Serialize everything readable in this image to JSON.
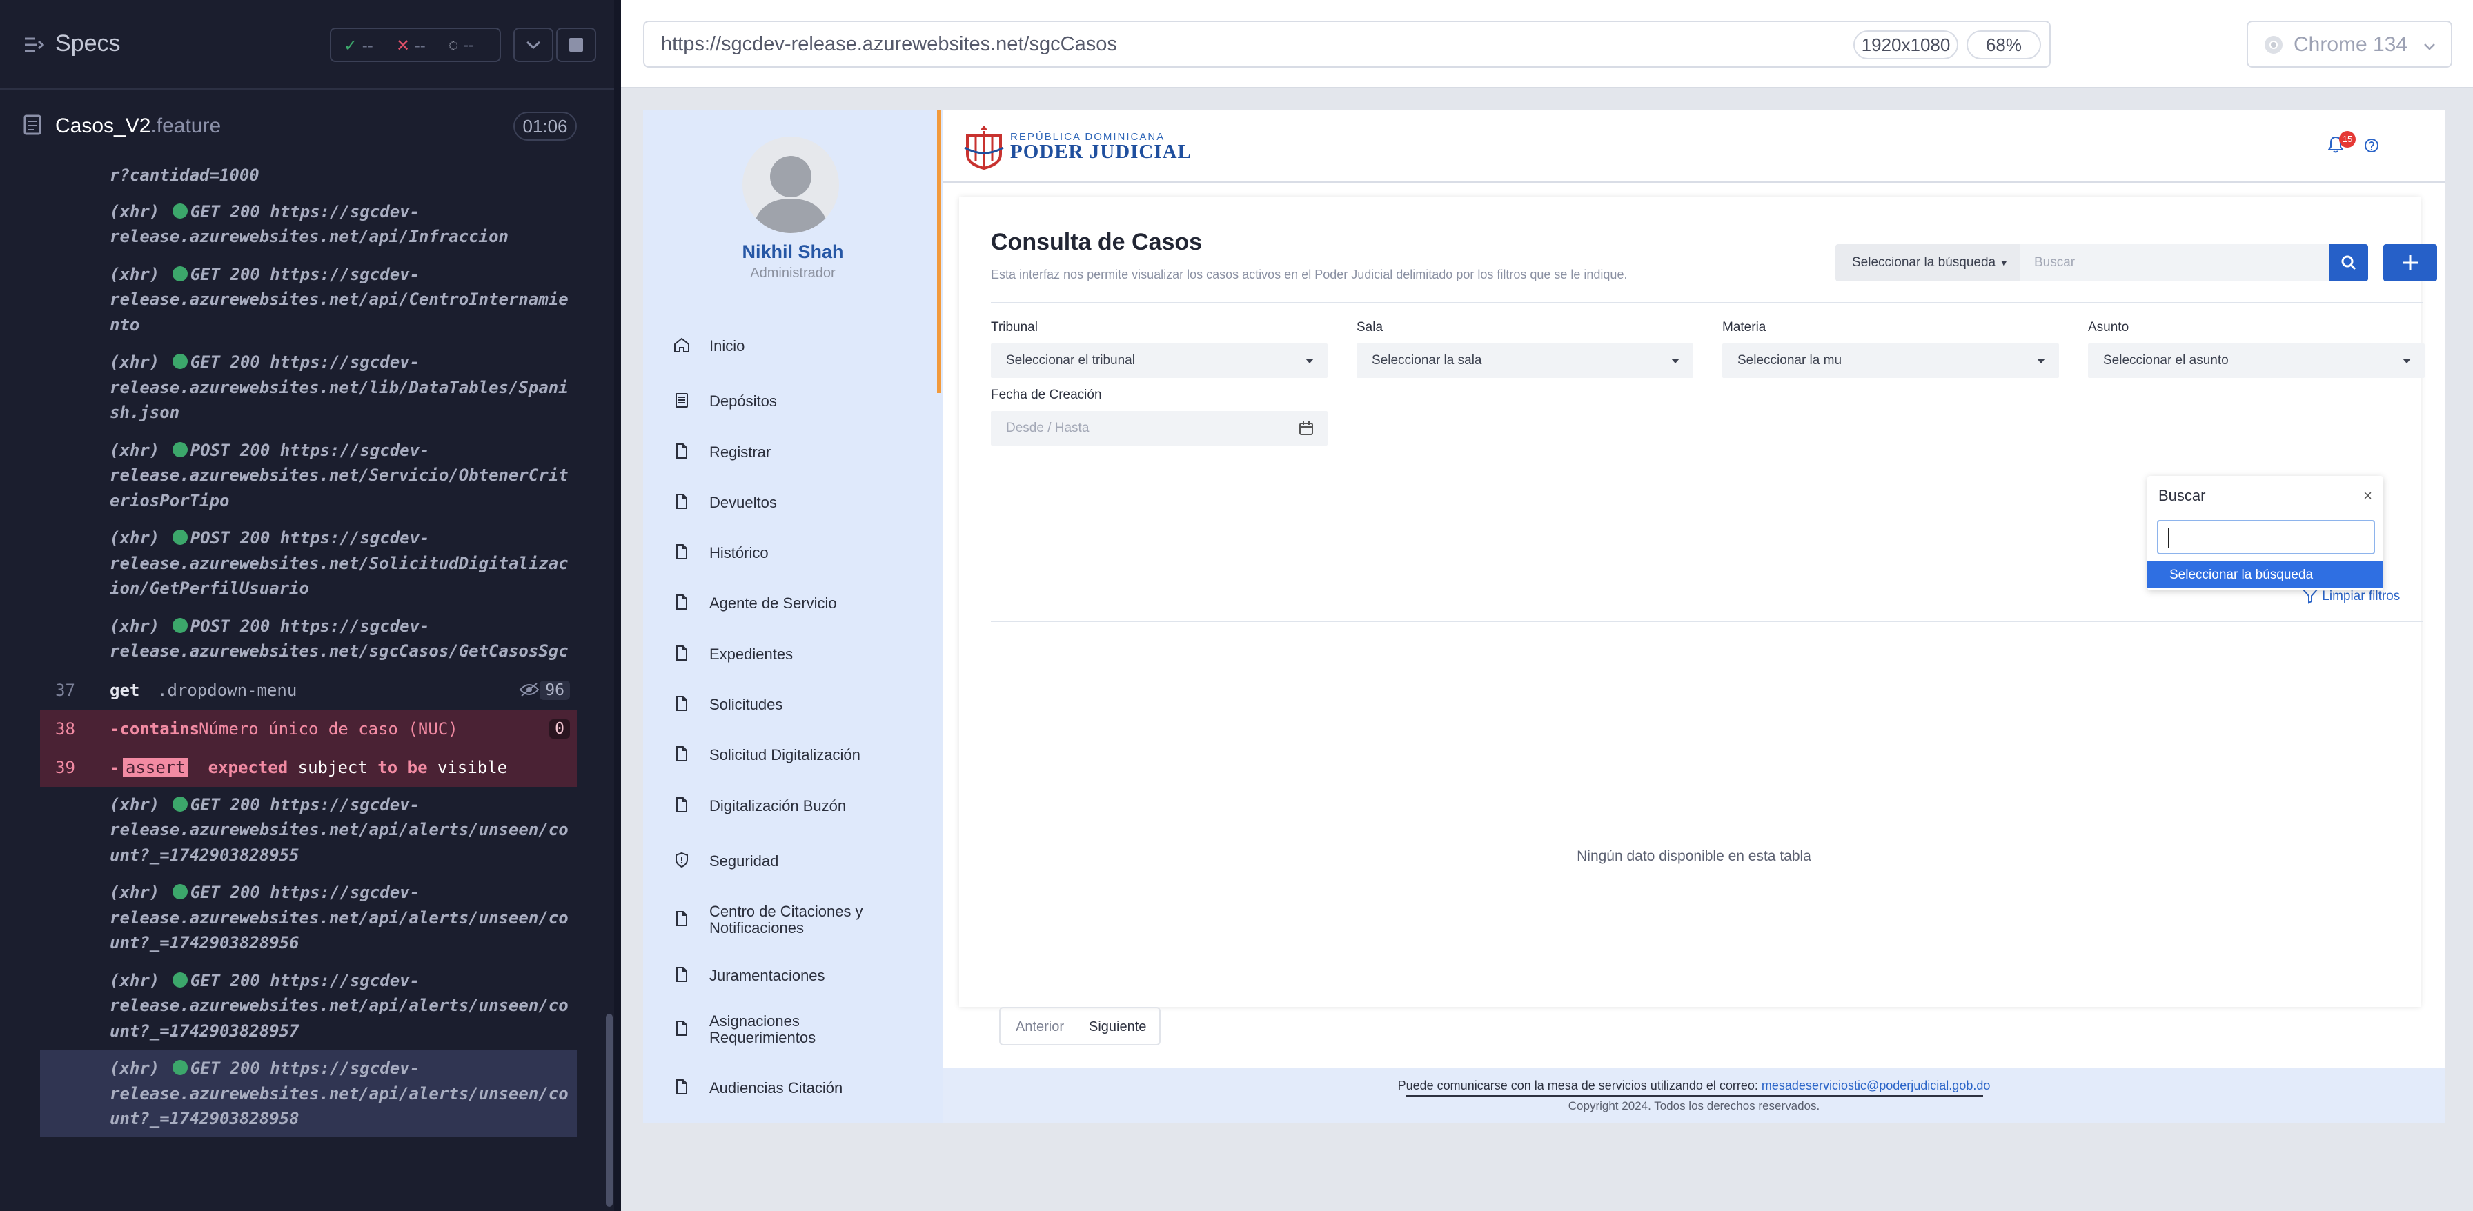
{
  "runner": {
    "title": "Specs",
    "stats": {
      "passed": "--",
      "failed": "--",
      "pending": "--"
    },
    "file": {
      "name": "Casos_V2",
      "ext": ".feature",
      "time": "01:06"
    },
    "log_top": [
      {
        "kind": "frag",
        "text": "r?cantidad=1000"
      },
      {
        "kind": "xhr",
        "lines": [
          "GET 200 https://sgcdev-",
          "release.azurewebsites.net/api/Infraccion"
        ]
      },
      {
        "kind": "xhr",
        "lines": [
          "GET 200 https://sgcdev-",
          "release.azurewebsites.net/api/CentroInternamie",
          "nto"
        ]
      },
      {
        "kind": "xhr",
        "lines": [
          "GET 200 https://sgcdev-",
          "release.azurewebsites.net/lib/DataTables/Spani",
          "sh.json"
        ]
      },
      {
        "kind": "xhr",
        "lines": [
          "POST 200 https://sgcdev-",
          "release.azurewebsites.net/Servicio/ObtenerCrit",
          "eriosPorTipo"
        ]
      },
      {
        "kind": "xhr",
        "lines": [
          "POST 200 https://sgcdev-",
          "release.azurewebsites.net/SolicitudDigitalizac",
          "ion/GetPerfilUsuario"
        ]
      },
      {
        "kind": "xhr",
        "lines": [
          "POST 200 https://sgcdev-",
          "release.azurewebsites.net/sgcCasos/GetCasosSgc"
        ]
      }
    ],
    "cmd37": {
      "num": "37",
      "name": "get",
      "msg": ".dropdown-menu",
      "count": "96"
    },
    "cmd38": {
      "num": "38",
      "name": "-contains",
      "msg": "Número único de caso (NUC)",
      "count": "0"
    },
    "cmd39": {
      "num": "39",
      "name": "-",
      "tag": "assert",
      "w1": "expected",
      "w2": "subject",
      "w3": "to be",
      "w4": "visible"
    },
    "log_bottom": [
      {
        "kind": "xhr",
        "lines": [
          "GET 200 https://sgcdev-",
          "release.azurewebsites.net/api/alerts/unseen/co",
          "unt?_=1742903828955"
        ]
      },
      {
        "kind": "xhr",
        "lines": [
          "GET 200 https://sgcdev-",
          "release.azurewebsites.net/api/alerts/unseen/co",
          "unt?_=1742903828956"
        ]
      },
      {
        "kind": "xhr",
        "lines": [
          "GET 200 https://sgcdev-",
          "release.azurewebsites.net/api/alerts/unseen/co",
          "unt?_=1742903828957"
        ]
      },
      {
        "kind": "xhr",
        "sel": true,
        "lines": [
          "GET 200 https://sgcdev-",
          "release.azurewebsites.net/api/alerts/unseen/co",
          "unt?_=1742903828958"
        ]
      }
    ]
  },
  "browser": {
    "url": "https://sgcdev-release.azurewebsites.net/sgcCasos",
    "viewport": "1920x1080",
    "zoom": "68%",
    "name": "Chrome 134"
  },
  "app": {
    "user": {
      "name": "Nikhil Shah",
      "role": "Administrador"
    },
    "logo": {
      "line1": "REPÚBLICA DOMINICANA",
      "line2": "PODER JUDICIAL"
    },
    "notifications": "15",
    "nav": [
      {
        "label": "Inicio",
        "icon": "home-icon"
      },
      {
        "label": "Depósitos",
        "icon": "archive-icon"
      },
      {
        "label": "Registrar",
        "icon": "file-icon"
      },
      {
        "label": "Devueltos",
        "icon": "file-icon"
      },
      {
        "label": "Histórico",
        "icon": "file-icon"
      },
      {
        "label": "Agente de Servicio",
        "icon": "file-icon"
      },
      {
        "label": "Expedientes",
        "icon": "file-icon"
      },
      {
        "label": "Solicitudes",
        "icon": "file-icon"
      },
      {
        "label": "Solicitud Digitalización",
        "icon": "file-icon"
      },
      {
        "label": "Digitalización Buzón",
        "icon": "file-icon"
      },
      {
        "label": "Seguridad",
        "icon": "shield-icon"
      },
      {
        "label": "Centro de Citaciones y Notificaciones",
        "icon": "file-icon"
      },
      {
        "label": "Juramentaciones",
        "icon": "file-icon"
      },
      {
        "label": "Asignaciones Requerimientos",
        "icon": "file-icon"
      },
      {
        "label": "Audiencias Citación",
        "icon": "file-icon"
      }
    ],
    "page": {
      "title": "Consulta de Casos",
      "desc": "Esta interfaz nos permite visualizar los casos activos en el Poder Judicial delimitado por los filtros que se le indique.",
      "search_select": "Seleccionar la búsqueda",
      "search_placeholder": "Buscar",
      "filters": {
        "tribunal": {
          "label": "Tribunal",
          "value": "Seleccionar el tribunal"
        },
        "sala": {
          "label": "Sala",
          "value": "Seleccionar la sala"
        },
        "materia": {
          "label": "Materia",
          "value": "Seleccionar la mu"
        },
        "asunto": {
          "label": "Asunto",
          "value": "Seleccionar el asunto"
        },
        "fecha": {
          "label": "Fecha de Creación",
          "value": "Desde / Hasta"
        }
      },
      "clear": "Limpiar filtros",
      "empty": "Ningún dato disponible en esta tabla",
      "prev": "Anterior",
      "next": "Siguiente",
      "dropdown": {
        "title": "Buscar",
        "close": "×",
        "option": "Seleccionar la búsqueda"
      }
    },
    "footer": {
      "text": "Puede comunicarse con la mesa de servicios utilizando el correo:",
      "email": "mesadeserviciostic@poderjudicial.gob.do",
      "copyright": "Copyright 2024. Todos los derechos reservados."
    }
  }
}
